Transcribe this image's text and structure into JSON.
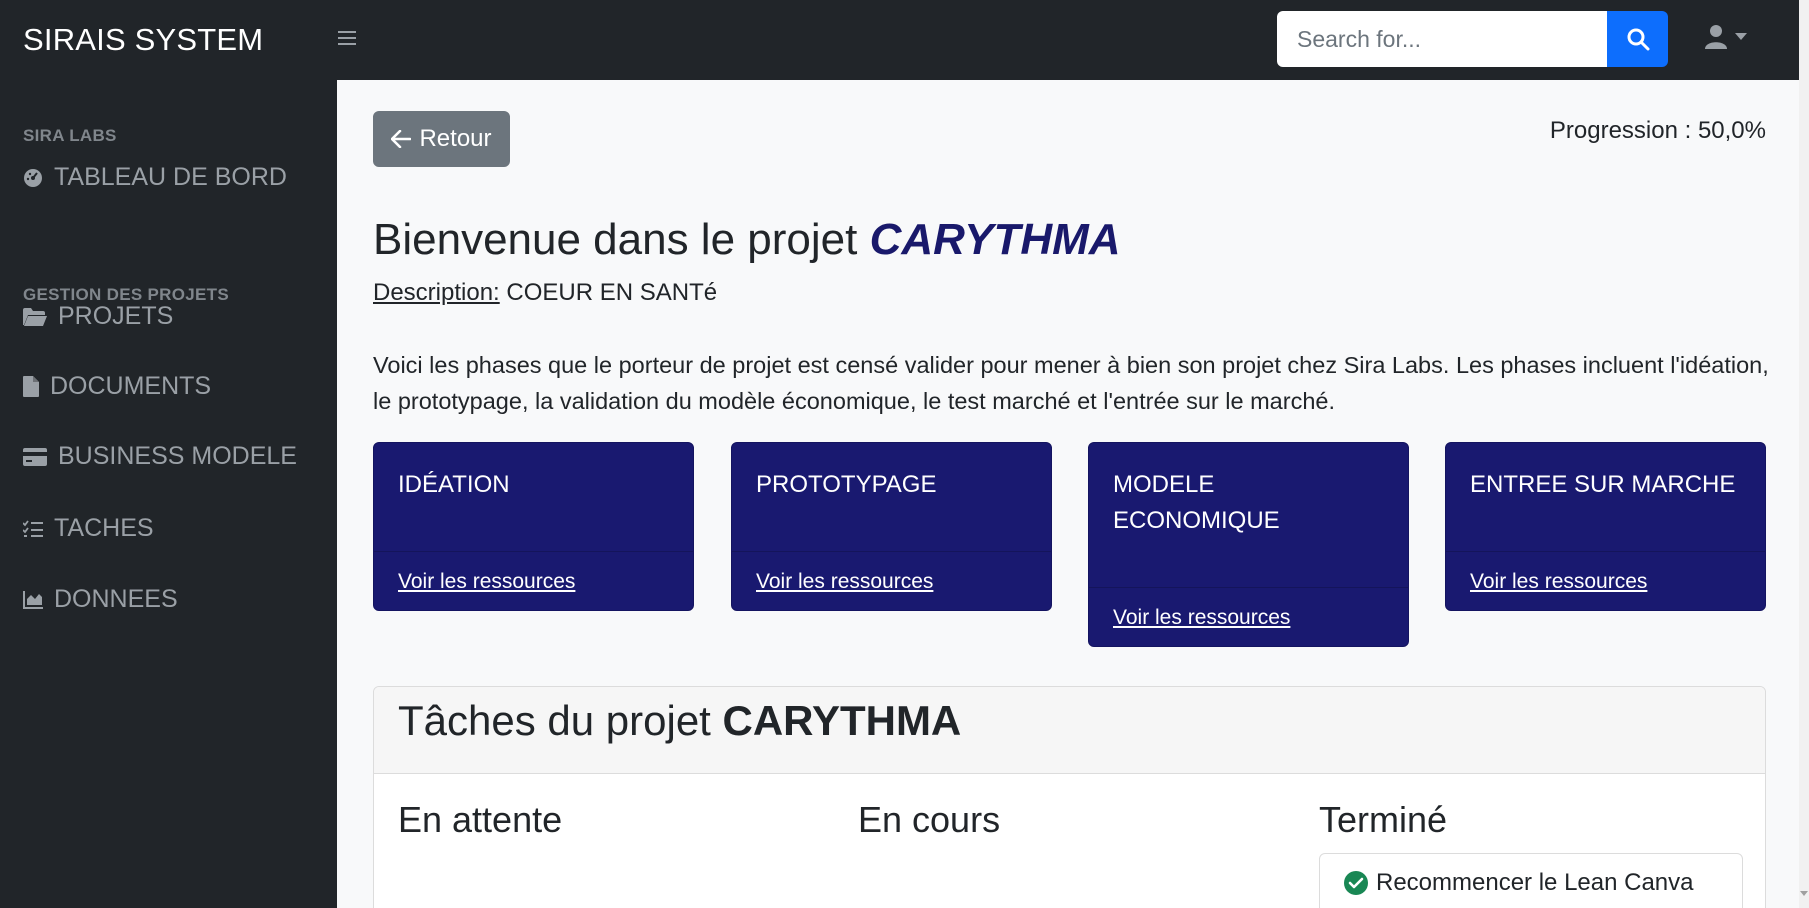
{
  "app": {
    "brand": "SIRAIS SYSTEM"
  },
  "search": {
    "placeholder": "Search for..."
  },
  "sidebar": {
    "sections": [
      {
        "heading": "SIRA LABS"
      },
      {
        "heading": "GESTION DES PROJETS"
      }
    ],
    "items": [
      {
        "label": "TABLEAU DE BORD",
        "icon": "dashboard-icon"
      },
      {
        "label": "PROJETS",
        "icon": "folder-open-icon"
      },
      {
        "label": "DOCUMENTS",
        "icon": "file-icon"
      },
      {
        "label": "BUSINESS MODELE",
        "icon": "credit-card-icon"
      },
      {
        "label": "TACHES",
        "icon": "task-list-icon"
      },
      {
        "label": "DONNEES",
        "icon": "area-chart-icon"
      }
    ]
  },
  "main": {
    "back_label": "Retour",
    "progress": "Progression : 50,0%",
    "welcome_prefix": "Bienvenue dans le projet ",
    "project_name": "CARYTHMA",
    "description_label": "Description:",
    "description_value": " COEUR EN SANTé",
    "intro": "Voici les phases que le porteur de projet est censé valider pour mener à bien son projet chez Sira Labs. Les phases incluent l'idéation, le prototypage, la validation du modèle économique, le test marché et l'entrée sur le marché.",
    "phases": [
      {
        "title": "IDÉATION",
        "link": "Voir les ressources"
      },
      {
        "title": "PROTOTYPAGE",
        "link": "Voir les ressources"
      },
      {
        "title": "MODELE ECONOMIQUE",
        "link": "Voir les ressources"
      },
      {
        "title": "ENTREE SUR MARCHE",
        "link": "Voir les ressources"
      }
    ],
    "tasks": {
      "title_prefix": "Tâches du projet ",
      "project_name": "CARYTHMA",
      "columns": [
        "En attente",
        "En cours",
        "Terminé"
      ],
      "done_items": [
        "Recommencer le Lean Canva"
      ]
    }
  },
  "colors": {
    "topbar": "#212529",
    "phase_card": "#191970",
    "search_button": "#0d6efd",
    "back_button": "#6c757d",
    "done_check": "#198754"
  }
}
